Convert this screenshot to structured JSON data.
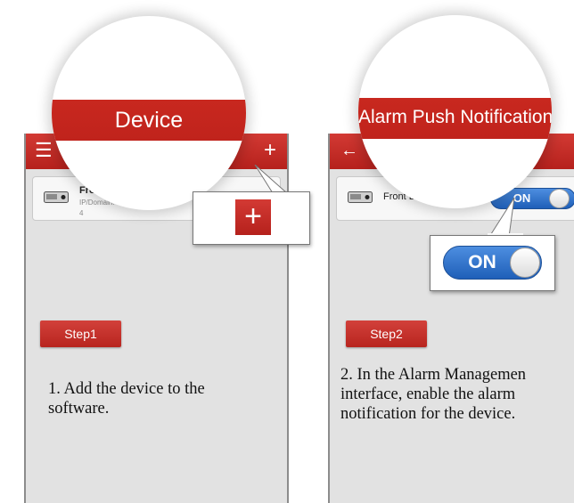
{
  "left_panel": {
    "zoom_title": "Device",
    "menu_icon": "hamburger-menu-icon",
    "add_icon": "plus-icon",
    "device": {
      "name": "Fro",
      "detail_line1": "IP/Domain:",
      "detail_line2": "4",
      "icon": "dvr-device-icon"
    },
    "callout_icon": "plus-icon",
    "step_label": "Step1",
    "instruction": "1.  Add the device to the software."
  },
  "right_panel": {
    "zoom_title": "Alarm Push Notification",
    "back_icon": "back-arrow-icon",
    "device": {
      "name": "Front D",
      "icon": "dvr-device-icon"
    },
    "toggle_label": "ON",
    "callout_toggle_label": "ON",
    "toggle_state": "on",
    "step_label": "Step2",
    "instruction": "2.  In the Alarm Managemen interface, enable the alarm notification for the device."
  },
  "colors": {
    "appbar_red": "#c0231c",
    "toggle_blue": "#2f6fcc",
    "screen_gray": "#e2e2e2"
  }
}
